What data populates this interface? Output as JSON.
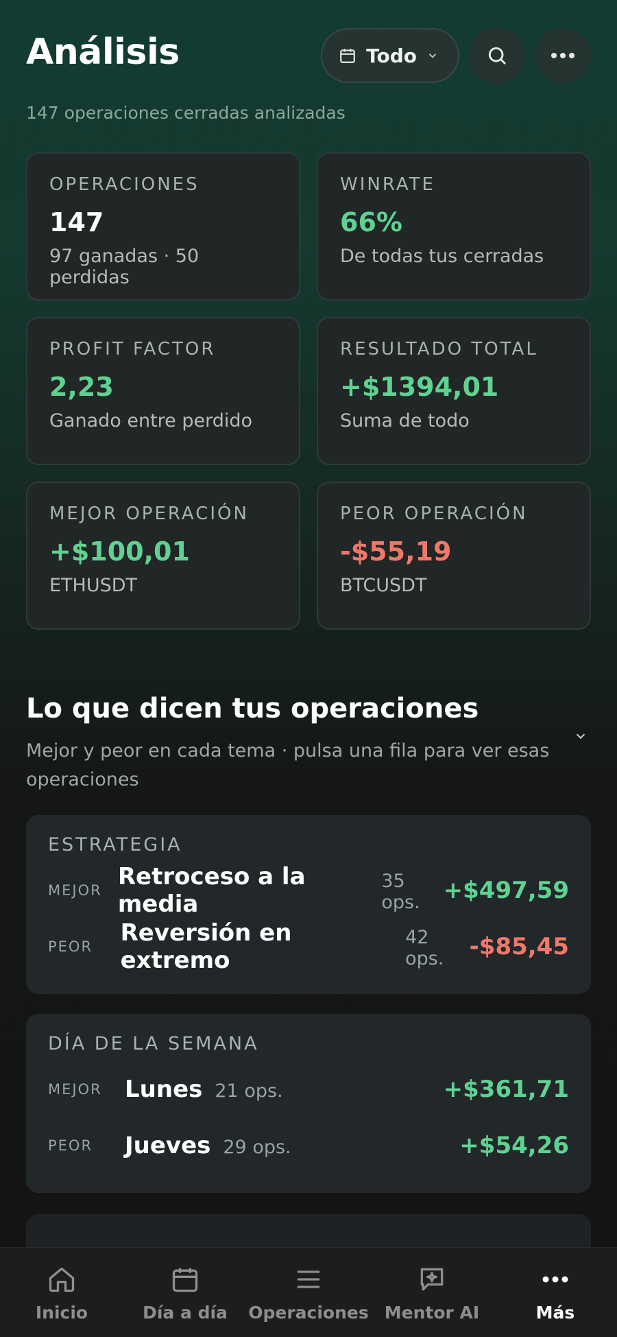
{
  "header": {
    "title": "Análisis",
    "filter_label": "Todo",
    "subtitle": "147 operaciones cerradas analizadas"
  },
  "stats": [
    {
      "label": "OPERACIONES",
      "value": "147",
      "sub": "97 ganadas · 50 perdidas",
      "tone": "neutral"
    },
    {
      "label": "WINRATE",
      "value": "66%",
      "sub": "De todas tus cerradas",
      "tone": "positive"
    },
    {
      "label": "PROFIT FACTOR",
      "value": "2,23",
      "sub": "Ganado entre perdido",
      "tone": "positive"
    },
    {
      "label": "RESULTADO TOTAL",
      "value": "+$1394,01",
      "sub": "Suma de todo",
      "tone": "positive"
    },
    {
      "label": "MEJOR OPERACIÓN",
      "value": "+$100,01",
      "sub": "ETHUSDT",
      "tone": "positive"
    },
    {
      "label": "PEOR OPERACIÓN",
      "value": "-$55,19",
      "sub": "BTCUSDT",
      "tone": "negative"
    }
  ],
  "insights": {
    "title": "Lo que dicen tus operaciones",
    "description": "Mejor y peor en cada tema · pulsa una fila para ver esas operaciones",
    "panels": [
      {
        "title": "ESTRATEGIA",
        "best": {
          "tag": "MEJOR",
          "name": "Retroceso a la media",
          "ops": "35 ops.",
          "amount": "+$497,59"
        },
        "worst": {
          "tag": "PEOR",
          "name": "Reversión en extremo",
          "ops": "42 ops.",
          "amount": "-$85,45"
        }
      },
      {
        "title": "DÍA DE LA SEMANA",
        "best": {
          "tag": "MEJOR",
          "name": "Lunes",
          "ops": "21 ops.",
          "amount": "+$361,71"
        },
        "worst": {
          "tag": "PEOR",
          "name": "Jueves",
          "ops": "29 ops.",
          "amount": "+$54,26"
        }
      }
    ]
  },
  "nav": [
    {
      "label": "Inicio",
      "icon": "home-icon"
    },
    {
      "label": "Día a día",
      "icon": "calendar-icon"
    },
    {
      "label": "Operaciones",
      "icon": "list-icon"
    },
    {
      "label": "Mentor AI",
      "icon": "chat-sparkle-icon"
    },
    {
      "label": "Más",
      "icon": "more-icon",
      "active": true
    }
  ],
  "colors": {
    "positive": "#5fd292",
    "negative": "#f0786b",
    "accent_bg": "#123b31"
  }
}
